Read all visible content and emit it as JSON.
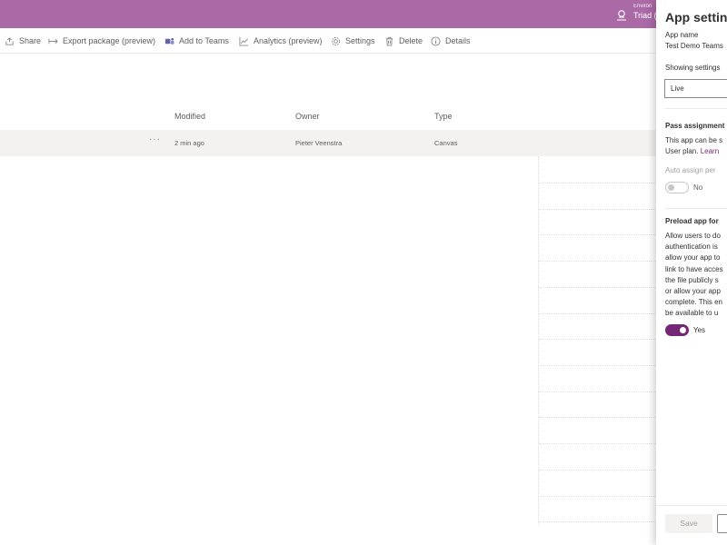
{
  "environment": {
    "label": "Environ",
    "name": "Triad ("
  },
  "commands": [
    {
      "label": "Share",
      "icon": "share-icon"
    },
    {
      "label": "Export package (preview)",
      "icon": "export-icon"
    },
    {
      "label": "Add to Teams",
      "icon": "teams-icon"
    },
    {
      "label": "Analytics (preview)",
      "icon": "analytics-icon"
    },
    {
      "label": "Settings",
      "icon": "gear-icon"
    },
    {
      "label": "Delete",
      "icon": "trash-icon"
    },
    {
      "label": "Details",
      "icon": "info-icon"
    }
  ],
  "table": {
    "columns": [
      "Modified",
      "Owner",
      "Type"
    ],
    "rows": [
      {
        "more": "···",
        "modified": "2 min ago",
        "owner": "Pieter Veenstra",
        "type": "Canvas"
      }
    ]
  },
  "panel": {
    "title": "App setting",
    "app_name_label": "App name",
    "app_name_value": "Test Demo Teams",
    "showing_label": "Showing settings",
    "showing_value": "Live",
    "pass_title": "Pass assignment",
    "pass_text": [
      "This app can be s",
      "User plan. "
    ],
    "pass_link": "Learn",
    "auto_assign_label": "Auto assign per",
    "auto_assign_value": "No",
    "preload_title": "Preload app for",
    "preload_text": [
      "Allow users to do",
      "authentication is",
      "allow your app to",
      "link to have acces",
      "the file publicly s",
      "or allow your app",
      "complete. This en",
      "be available to u"
    ],
    "preload_value": "Yes",
    "save_label": "Save"
  },
  "colors": {
    "accent": "#742774",
    "topbar": "#a96aa6"
  }
}
